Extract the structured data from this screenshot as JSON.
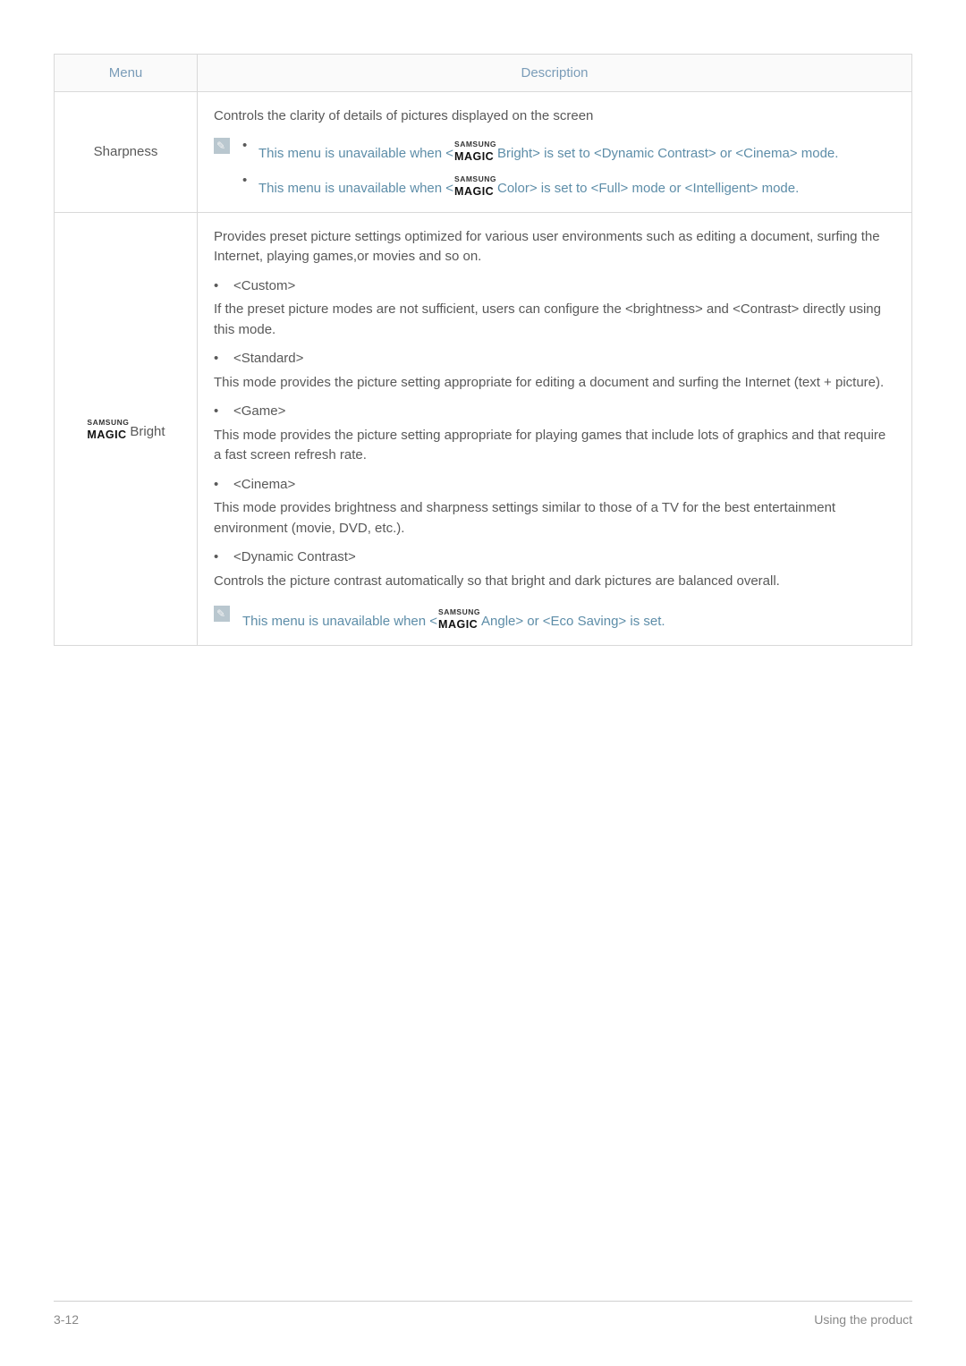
{
  "table": {
    "headers": {
      "menu": "Menu",
      "description": "Description"
    }
  },
  "magic": {
    "top": "SAMSUNG",
    "bot": "MAGIC"
  },
  "row1": {
    "menu": "Sharpness",
    "intro": "Controls the clarity of details of pictures displayed on the screen",
    "note1_pre": "This menu is unavailable when <",
    "note1_mid": "Bright> is set to <Dynamic Contrast> or <Cinema> mode.",
    "note2_pre": "This menu is unavailable when <",
    "note2_mid": "Color> is set to <Full> mode or <Intelligent> mode."
  },
  "row2": {
    "menu_suffix": "Bright",
    "intro": "Provides preset picture settings optimized for various user environments such as editing a document, surfing the Internet, playing games,or movies and so on.",
    "item1": {
      "label": "<Custom>",
      "desc": "If the preset picture modes are not sufficient, users can configure the <brightness> and <Contrast> directly using this mode."
    },
    "item2": {
      "label": "<Standard>",
      "desc": " This mode provides the picture setting appropriate for editing a document and surfing the Internet (text + picture)."
    },
    "item3": {
      "label": "<Game>",
      "desc": "This mode provides the picture setting appropriate for playing games that include lots of graphics and that require a fast screen refresh rate."
    },
    "item4": {
      "label": "<Cinema>",
      "desc": "This mode provides brightness and sharpness settings similar to those of a TV for the best entertainment environment (movie, DVD, etc.)."
    },
    "item5": {
      "label": "<Dynamic Contrast>",
      "desc": "Controls the picture contrast automatically so that bright and dark pictures are balanced overall."
    },
    "note_pre": "This menu is unavailable when <",
    "note_post": "Angle> or <Eco Saving> is set."
  },
  "footer": {
    "left": "3-12",
    "right": "Using the product"
  }
}
